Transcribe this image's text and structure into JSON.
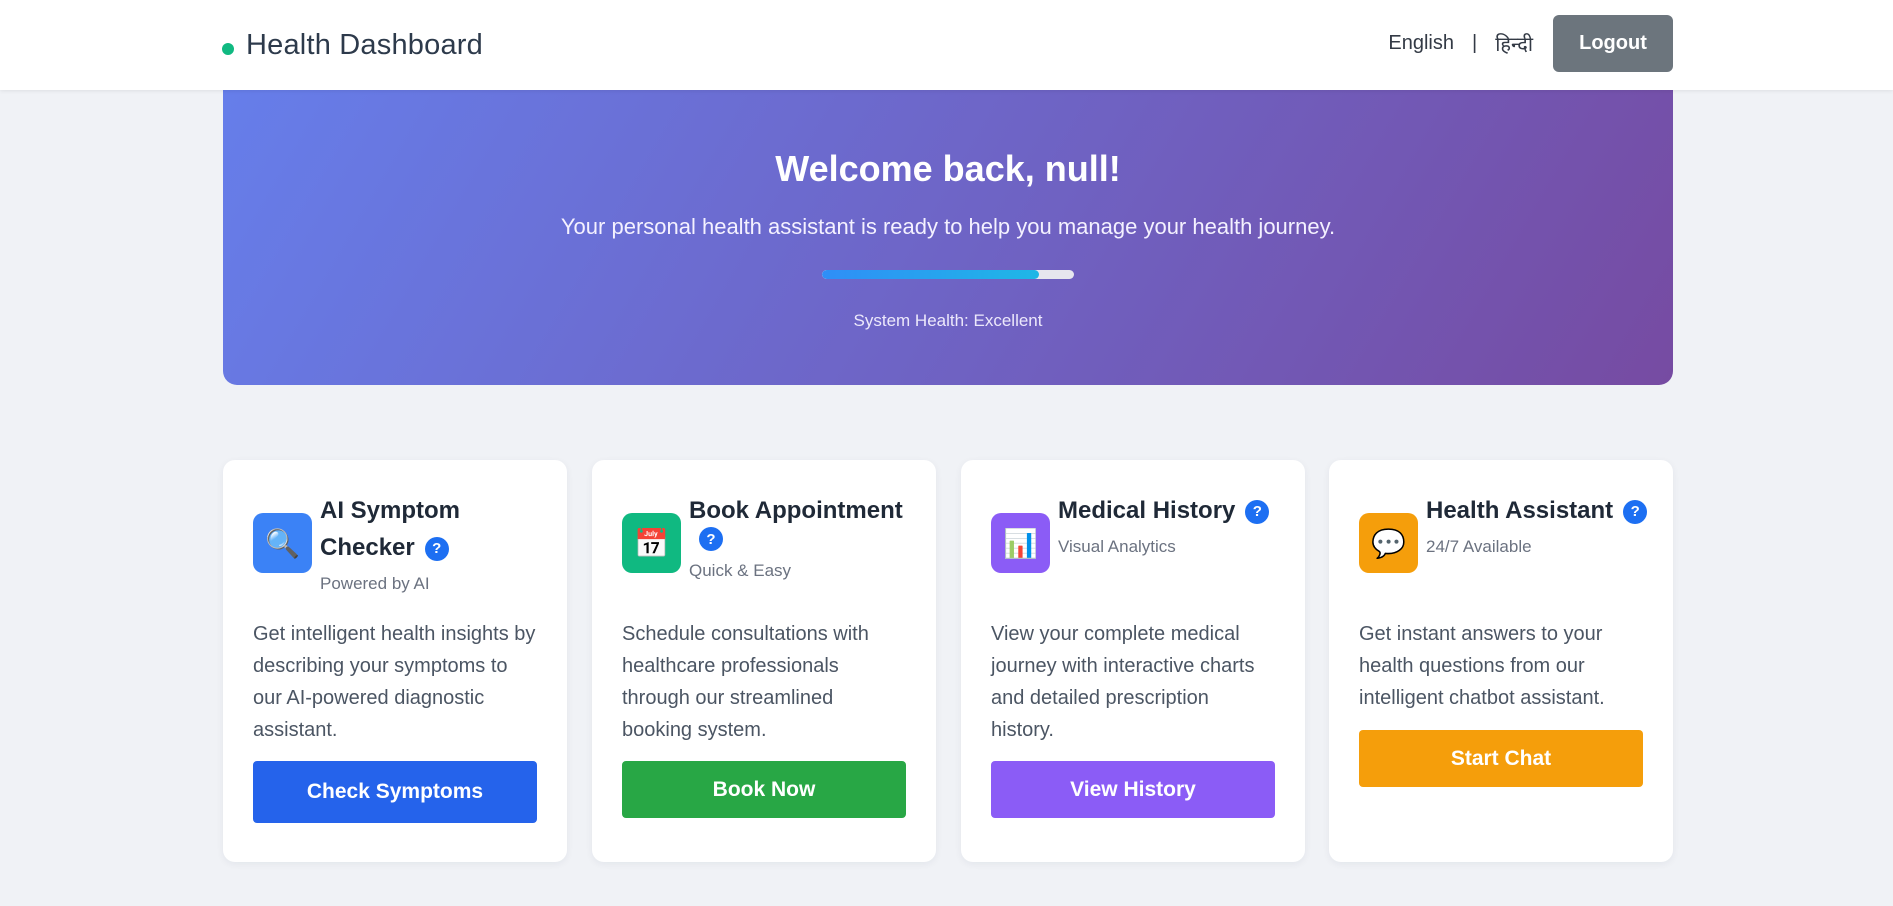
{
  "header": {
    "title": "Health Dashboard",
    "languages": [
      "English",
      "हिन्दी"
    ],
    "separator": "|",
    "logout_label": "Logout"
  },
  "hero": {
    "title": "Welcome back, null!",
    "subtitle": "Your personal health assistant is ready to help you manage your health journey.",
    "progress_fraction": 0.86,
    "status": "System Health: Excellent"
  },
  "cards": [
    {
      "icon": "magnifier-icon",
      "icon_glyph": "🔍",
      "icon_bg": "#3b82f6",
      "title": "AI Symptom Checker",
      "help": "?",
      "meta": "Powered by AI",
      "description": "Get intelligent health insights by describing your symptoms to our AI-powered diagnostic assistant.",
      "button": "Check Symptoms",
      "button_color": "#2563eb"
    },
    {
      "icon": "calendar-icon",
      "icon_glyph": "📅",
      "icon_bg": "#10b981",
      "title": "Book Appointment",
      "help": "?",
      "meta": "Quick & Easy",
      "description": "Schedule consultations with healthcare professionals through our streamlined booking system.",
      "button": "Book Now",
      "button_color": "#28a745"
    },
    {
      "icon": "bar-chart-icon",
      "icon_glyph": "📊",
      "icon_bg": "#8b5cf6",
      "title": "Medical History",
      "help": "?",
      "meta": "Visual Analytics",
      "description": "View your complete medical journey with interactive charts and detailed prescription history.",
      "button": "View History",
      "button_color": "#8b5cf6"
    },
    {
      "icon": "speech-bubble-icon",
      "icon_glyph": "💬",
      "icon_bg": "#f59e0b",
      "title": "Health Assistant",
      "help": "?",
      "meta": "24/7 Available",
      "description": "Get instant answers to your health questions from our intelligent chatbot assistant.",
      "button": "Start Chat",
      "button_color": "#f59e0b"
    }
  ]
}
